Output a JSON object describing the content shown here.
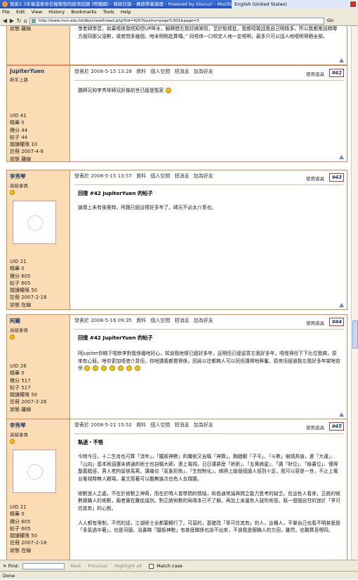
{
  "window": {
    "title": "我家2.3年後還係收信幾奪勁的經濟話題 (際關網) - 條款討論 - 萬德學會論壇 - Powered by Discuz! - Mozilla Firefox",
    "lang": "English (United States)"
  },
  "menu": [
    "File",
    "Edit",
    "View",
    "History",
    "Bookmarks",
    "Tools",
    "Help"
  ],
  "url": "http://www.mvs.edu.hk/bbs/viewthread.php?tid=4267&extra=page%3D1&page=3",
  "go_label": "Go",
  "post0": {
    "name": "狀態 離線",
    "body": "學老師學習，如果唔係我唔知但UP咩水，解釋錯左我好搞笑啦，至於點樣批，我都唔敢話我自己明條多，所以我都應該睇嚟方面同那父語數，或者問多幾個，咁未明點批算囉。” 同唔係一口咬定人地一定唔明，最多只可以話人地唔明得晒全部。"
  },
  "posts": [
    {
      "name": "JupiterYuen",
      "group": "新手上路",
      "uid": "UID 41",
      "essence": "精華 0",
      "points": "積分 44",
      "posts": "帖子 44",
      "perm": "閱讀權限 10",
      "reg": "註冊 2007-4-8",
      "status": "狀態 離線",
      "date": "發表於 2008-5-15 13:28",
      "links": [
        "資料",
        "個人空間",
        "短消息",
        "加為好友"
      ],
      "tools": "使用道具",
      "floor": "#42",
      "subject": "",
      "body": "雞師兄和李秀琴師兄好像前世已經是冤家"
    },
    {
      "name": "李秀琴",
      "group": "高級會員",
      "uid": "UID 21",
      "essence": "精華 0",
      "points": "積分 605",
      "posts": "帖子 605",
      "perm": "閱讀權限 50",
      "reg": "註冊 2007-2-18",
      "status": "狀態 在線",
      "date": "發表於 2008-5-15 13:57",
      "links": [
        "資料",
        "個人空間",
        "短消息",
        "加為好友"
      ],
      "tools": "使用道具",
      "floor": "#43",
      "subject": "回復 #42 JupiterYuen 的帖子",
      "body": "論壇上未有後輩時，阿雞已經這樣好多年了。師兄不必太介意也。"
    },
    {
      "name": "阿雞",
      "group": "高級會員",
      "uid": "UID 26",
      "essence": "精華 0",
      "points": "積分 517",
      "posts": "帖子 517",
      "perm": "閱讀權限 50",
      "reg": "註冊 2007-2-26",
      "status": "狀態 離線",
      "date": "發表於 2008-5-16 09:35",
      "links": [
        "資料",
        "個人空間",
        "短消息",
        "加為好友"
      ],
      "tools": "使用道具",
      "floor": "#44",
      "subject": "回復 #42 JupiterYuen 的帖子",
      "body": "阿jupiter你睇下啦默李對我係幾咁好心，知道我咁樣已經好多年，証明佢已經留意左我好多年，唔怪得佢下下比位我搞，原來有心既，咁你更加唔使介意佢，你咁講我都覺得係，因爲以往都無人可以同佢講得咁興奮，原來佢經過我左我好多年架咁前世"
    },
    {
      "name": "李秀琴",
      "group": "高級會員",
      "uid": "UID 21",
      "essence": "精華 0",
      "points": "積分 605",
      "posts": "帖子 605",
      "perm": "閱讀權限 50",
      "reg": "註冊 2007-2-18",
      "status": "狀態 在線",
      "date": "發表於 2008-5-21 15:52",
      "links": [
        "資料",
        "個人空間",
        "短消息",
        "加為好友"
      ],
      "tools": "使用道具",
      "floor": "#45",
      "subject": "執迷・不悟",
      "body": "今時今日，十二生肖也可算「流年」，「鐵板神數」的職術又自稱「神算」，胸臆顯「子平」、「斗數」樹揹丼論，連「大運」、「山向」基本術語還未搞通的術士也自稱大師，連上電視，日日講甚麼「術術」、「五黃病星」、「講「財位」、「錄書位」、僅得整義艇徑，男人老拘留俠馬罵，講幾句「氣象形態」、「生尅制化」，搞得上級個個讀人徑到十足，我可以容是一世，不止上電台電視時無人踢場，書文寫著可以酷無論次也有人去撐腰。\n\n術數迷人之處，不在於術數之神奇，而在於時人普學問的情結，和普通常識與開之能力思考的缺乏。在這些人看來，正統的術數跟職人的術數，兩者實在難從識別。對正統術數的局限本已不了解，再加上身邊有人鼓吹術徑，既一個個自甘的迷於「爭可信其有」的心態。\n\n人人都有限制，不然的話，江湖術士全都要轉行了。可惡的，基礎改「寧可信其有」的人，這種人，不單自己也看不明甚麼是「多氣過中著」，也是河國，浴書睇「鐵板神數」有甚麼關係也說不出來，不過我是跟職人的方回，雖然，也難算吾嘢四。"
    }
  ],
  "find": {
    "label": "Find:",
    "next": "Next",
    "previous": "Previous",
    "highlight": "Highlight all",
    "match": "Match case"
  },
  "status": "Done"
}
